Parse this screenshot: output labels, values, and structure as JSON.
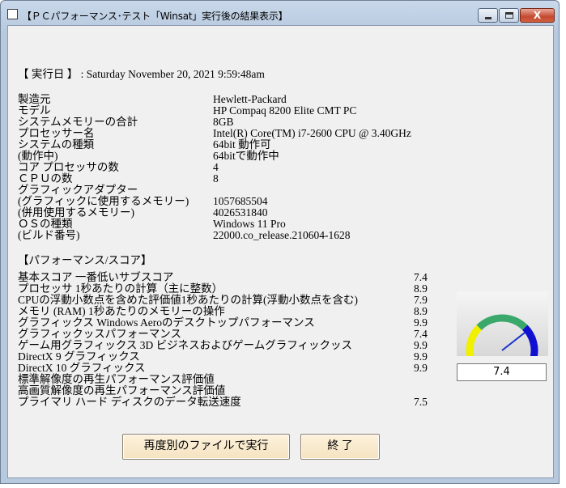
{
  "window": {
    "title": "【ＰＣパフォーマンス･テスト「Winsat」実行後の結果表示】",
    "close_label": "X"
  },
  "run_date": {
    "label": "【 実行日 】 : Saturday November 20, 2021  9:59:48am"
  },
  "system_info": [
    {
      "label": "製造元",
      "value": "Hewlett-Packard"
    },
    {
      "label": "モデル",
      "value": "HP Compaq 8200 Elite CMT PC"
    },
    {
      "label": "システムメモリーの合計",
      "value": "8GB"
    },
    {
      "label": "プロセッサー名",
      "value": "Intel(R) Core(TM) i7-2600 CPU @ 3.40GHz"
    },
    {
      "label": "システムの種類",
      "value": "64bit 動作可"
    },
    {
      "label": "        (動作中)",
      "value": "64bitで動作中"
    },
    {
      "label": "コア プロセッサの数",
      "value": "4"
    },
    {
      "label": "ＣＰＵの数",
      "value": "8"
    },
    {
      "label": "グラフィックアダプター",
      "value": ""
    },
    {
      "label": " (グラフィックに使用するメモリー)",
      "value": "1057685504"
    },
    {
      "label": " (併用使用するメモリー)",
      "value": "4026531840"
    },
    {
      "label": "ＯＳの種類",
      "value": "Windows 11 Pro"
    },
    {
      "label": "            (ビルド番号)",
      "value": "22000.co_release.210604-1628"
    }
  ],
  "performance": {
    "heading": "【パフォーマンス/スコア】",
    "rows": [
      {
        "label": "基本スコア  一番低いサブスコア",
        "score": "7.4"
      },
      {
        "label": "プロセッサ      1秒あたりの計算（主に整数）",
        "score": "8.9"
      },
      {
        "label": "CPUの浮動小数点を含めた評価値1秒あたりの計算(浮動小数点を含む)",
        "score": "7.9"
      },
      {
        "label": "メモリ (RAM)      1秒あたりのメモリーの操作",
        "score": "8.9"
      },
      {
        "label": "グラフィックス   Windows Aeroのデスクトップパフォーマンス",
        "score": "9.9"
      },
      {
        "label": "グラフィックッスパフォーマンス",
        "score": "7.4"
      },
      {
        "label": "ゲーム用グラフィックス  3D ビジネスおよびゲームグラフィックッス",
        "score": "9.9"
      },
      {
        "label": "DirectX 9 グラフィックス",
        "score": "9.9"
      },
      {
        "label": "DirectX 10 グラフィックス",
        "score": "9.9"
      },
      {
        "label": "標準解像度の再生パフォーマンス評価値",
        "score": ""
      },
      {
        "label": "高画質解像度の再生パフォーマンス評価値",
        "score": ""
      },
      {
        "label": "プライマリ ハード ディスクのデータ転送速度",
        "score": "7.5"
      }
    ]
  },
  "gauge": {
    "value": "7.4",
    "level": 7.4,
    "max": 9.9,
    "colors": {
      "low": "#f0f000",
      "mid": "#3aa86a",
      "high": "#1010d0",
      "needle": "#1a33cc"
    }
  },
  "buttons": {
    "run_other": "再度別のファイルで実行",
    "exit": "終  了"
  }
}
